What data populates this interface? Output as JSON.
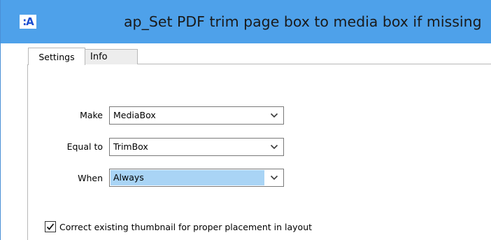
{
  "window": {
    "title": "ap_Set PDF trim page box to media box if missing",
    "app_icon_text": ":A",
    "app_icon": "app-logo-icon",
    "titlebar_color": "#4ea1ea"
  },
  "tabs": [
    {
      "label": "Settings",
      "active": true
    },
    {
      "label": "Info",
      "active": false
    }
  ],
  "form": {
    "make": {
      "label": "Make",
      "value": "MediaBox"
    },
    "equal_to": {
      "label": "Equal to",
      "value": "TrimBox"
    },
    "when": {
      "label": "When",
      "value": "Always",
      "highlight_color": "#a9d4f5"
    }
  },
  "options": {
    "correct_thumbnail": {
      "label": "Correct existing thumbnail for proper placement in layout",
      "checked": true
    }
  },
  "icons": {
    "dropdown": "chevron-down-icon",
    "checkbox": "checkmark-icon"
  }
}
